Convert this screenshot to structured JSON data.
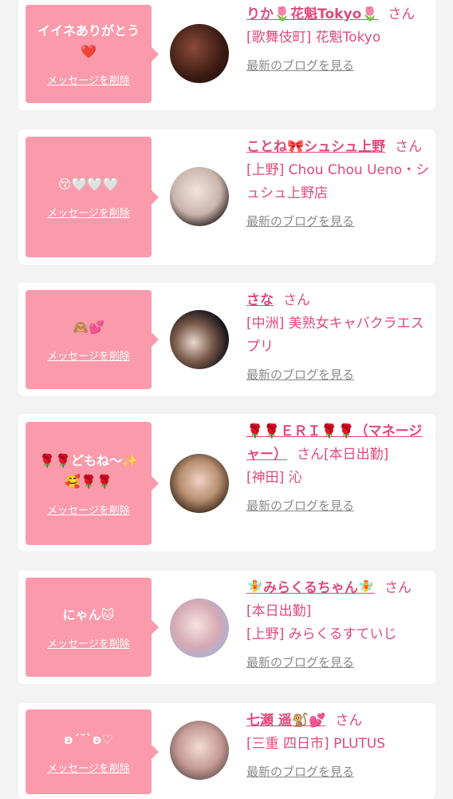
{
  "delete_label": "メッセージを削除",
  "blog_label": "最新のブログを見る",
  "san_label": "さん",
  "cards": [
    {
      "message": "イイネありがとう",
      "message_emoji": "❤️",
      "name": "りか🌷花魁Tokyo🌷",
      "status": "",
      "shop": "[歌舞伎町] 花魁Tokyo"
    },
    {
      "message": "😚🤍🤍🤍",
      "message_emoji": "",
      "name": "ことね🎀シュシュ上野",
      "status": "",
      "shop": "[上野] Chou Chou Ueno・シュシュ上野店"
    },
    {
      "message": "🙈💕",
      "message_emoji": "",
      "name": "さな",
      "status": "",
      "shop": "[中洲] 美熟女キャバクラエスプリ"
    },
    {
      "message": "🌹🌹どもね〜✨",
      "message_emoji": "🥰🌹🌹",
      "name": "🌹🌹ＥＲＩ🌹🌹（マネージャー）",
      "status": "[本日出勤]",
      "shop": "[神田] 沁"
    },
    {
      "message": "にゃん🐱",
      "message_emoji": "",
      "name": "🧚みらくるちゃん🧚",
      "status": "[本日出勤]",
      "shop": "[上野] みらくるすていじ"
    },
    {
      "message": "ʚ´˘`ʚ♡",
      "message_emoji": "",
      "name": "七瀬 遥🐒💕",
      "status": "",
      "shop": "[三重 四日市] PLUTUS"
    }
  ],
  "avatar_icons": [
    "avatar-1",
    "avatar-2",
    "avatar-3",
    "avatar-4",
    "avatar-5",
    "avatar-6"
  ]
}
